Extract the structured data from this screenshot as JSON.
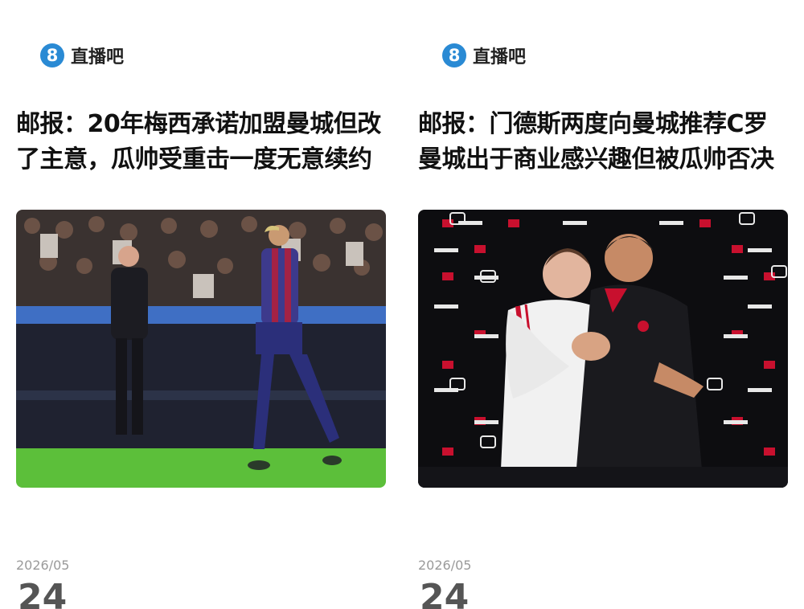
{
  "brand": {
    "name": "直播吧",
    "logo_glyph": "8",
    "logo_color": "#2a8ad4",
    "icon": "zhibo8-logo-icon"
  },
  "cards": [
    {
      "headline_line1": "邮报：20年梅西承诺加盟曼城但改",
      "headline_line2": "了主意，瓜帅受重击一度无意续约",
      "image": "messi-guardiola-photo",
      "date": "2026/05",
      "day": "24"
    },
    {
      "headline_line1": "邮报：门德斯两度向曼城推荐C罗",
      "headline_line2": "曼城出于商业感兴趣但被瓜帅否决",
      "image": "ronaldo-solskjaer-photo",
      "date": "2026/05",
      "day": "24"
    }
  ]
}
